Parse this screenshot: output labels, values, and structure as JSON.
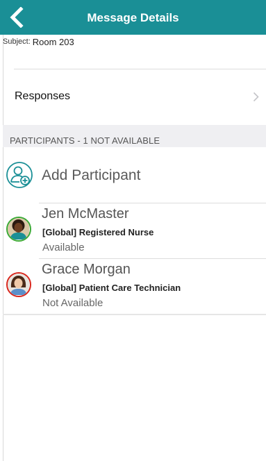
{
  "header": {
    "title": "Message Details",
    "back_icon": "chevron-left-icon",
    "background": "#1a8f96"
  },
  "subject": {
    "label": "Subject:",
    "value": "Room 203"
  },
  "responses": {
    "label": "Responses",
    "icon": "chevron-right-icon"
  },
  "participants_section": {
    "title": "PARTICIPANTS - 1 NOT AVAILABLE"
  },
  "add_participant": {
    "label": "Add Participant",
    "icon": "add-user-icon",
    "icon_color": "#1a8f96"
  },
  "participants": [
    {
      "name": "Jen McMaster",
      "role": "[Global] Registered Nurse",
      "status": "Available",
      "status_color": "#3aa935"
    },
    {
      "name": "Grace Morgan",
      "role": "[Global] Patient Care Technician",
      "status": "Not Available",
      "status_color": "#d9261c"
    }
  ]
}
